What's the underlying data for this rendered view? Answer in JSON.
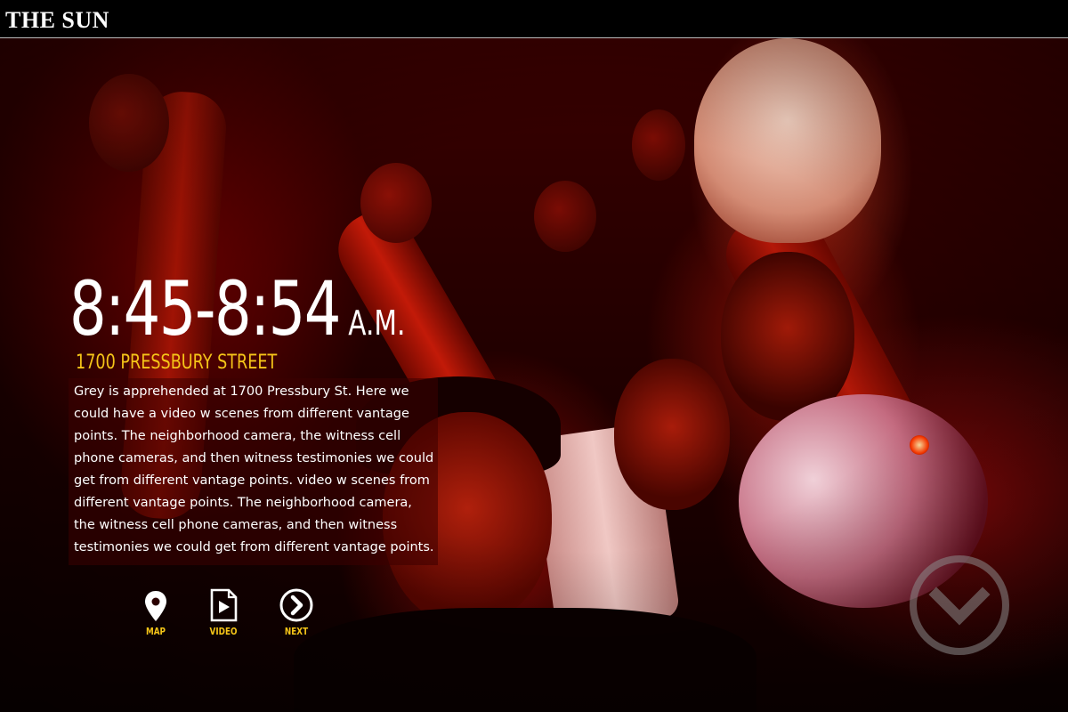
{
  "header": {
    "logo": "THE SUN"
  },
  "main": {
    "time_range": "8:45-8:54",
    "time_suffix": "A.M.",
    "address": "1700 PRESSBURY STREET",
    "body": "Grey is apprehended at 1700 Pressbury St. Here we could have a video w scenes from different vantage points. The neighborhood camera, the witness cell phone cameras, and then witness testimonies we could get from different vantage points.  video w scenes from different vantage points. The neighborhood camera, the witness cell phone cameras, and then witness testimonies we could get from different vantage points."
  },
  "actions": [
    {
      "label": "MAP",
      "icon": "map-pin-icon"
    },
    {
      "label": "VIDEO",
      "icon": "video-file-icon"
    },
    {
      "label": "NEXT",
      "icon": "next-arrow-icon"
    }
  ],
  "scroll_down": {
    "icon": "chevron-down-circle-icon"
  },
  "colors": {
    "accent": "#f5c518",
    "header_bg": "#000000",
    "text": "#ffffff"
  }
}
